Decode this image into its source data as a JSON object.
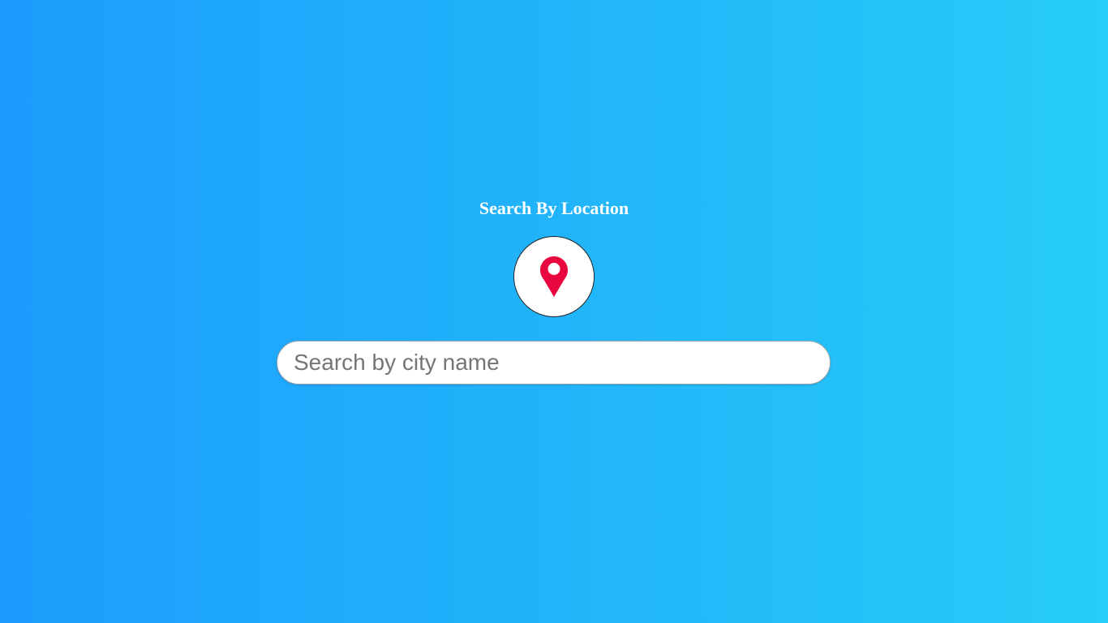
{
  "page": {
    "title": "Search By Location"
  },
  "location_icon": {
    "icon": "map-pin-icon",
    "color": "#e8073f"
  },
  "search": {
    "placeholder": "Search by city name",
    "value": ""
  },
  "colors": {
    "background_start": "#1c9cfd",
    "background_end": "#27ccf7",
    "title": "#ffffff"
  }
}
